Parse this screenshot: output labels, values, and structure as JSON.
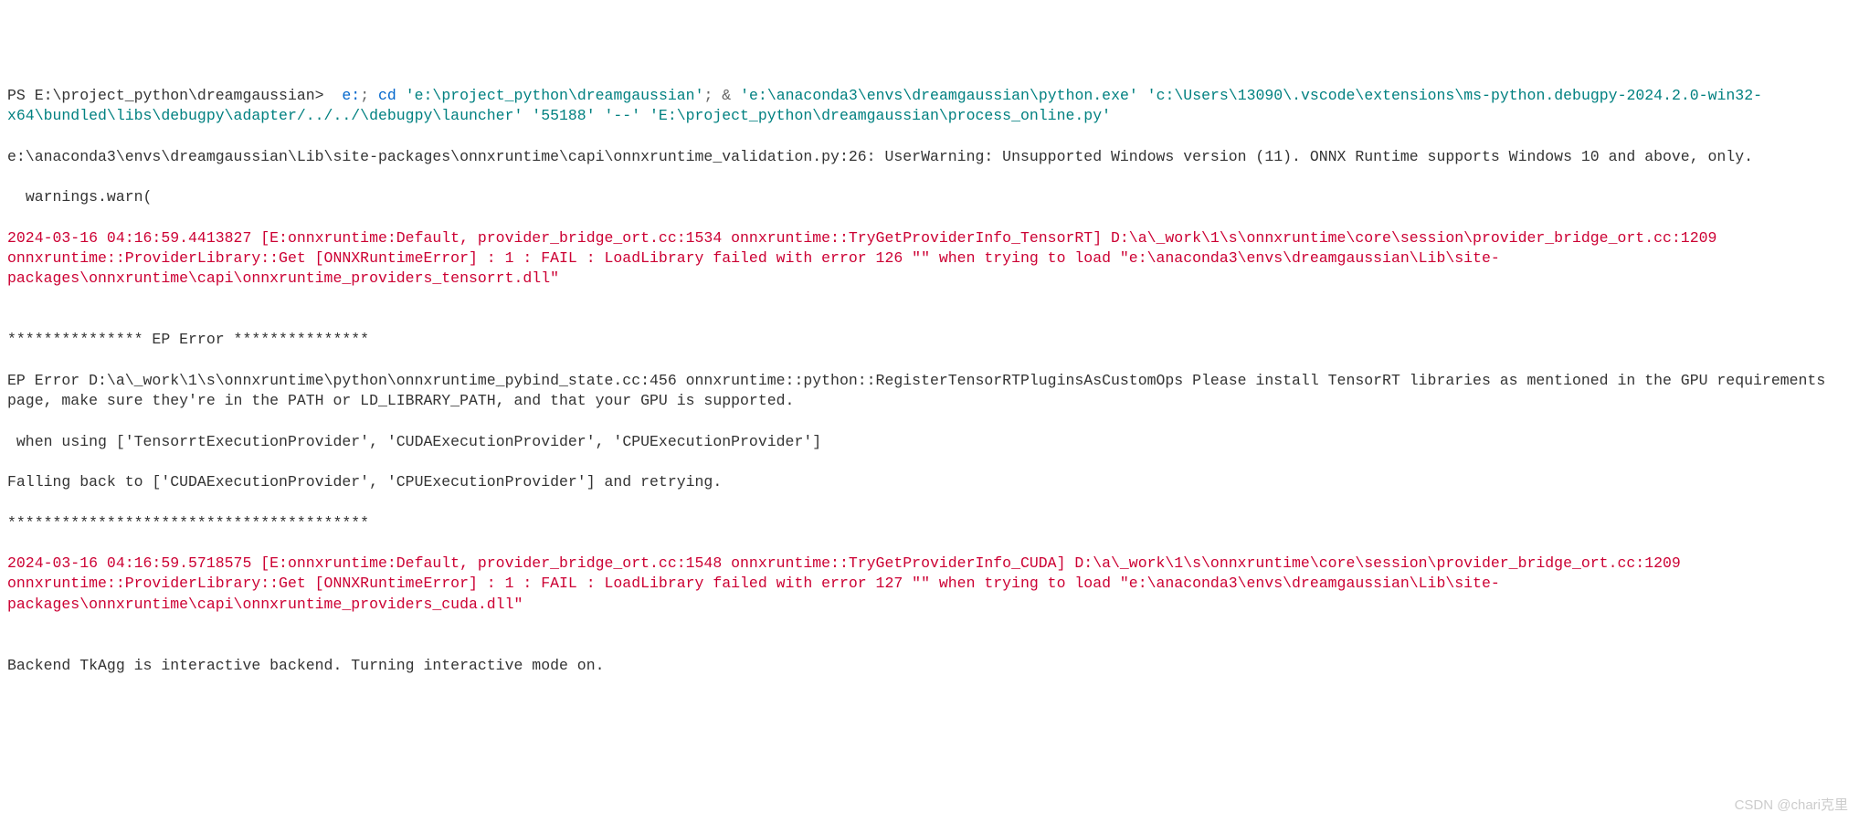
{
  "prompt": "PS E:\\project_python\\dreamgaussian>  ",
  "cmd_parts": {
    "part1": "e:",
    "part2": "; ",
    "part3": "cd",
    "part4": " ",
    "part5": "'e:\\project_python\\dreamgaussian'",
    "part6": "; ",
    "part7": "& ",
    "part8": "'e:\\anaconda3\\envs\\dreamgaussian\\python.exe' 'c:\\Users\\13090\\.vscode\\extensions\\ms-python.debugpy-2024.2.0-win32-x64\\bundled\\libs\\debugpy\\adapter/../../\\debugpy\\launcher' '55188' '--' 'E:\\project_python\\dreamgaussian\\process_online.py'"
  },
  "output": {
    "line1": "e:\\anaconda3\\envs\\dreamgaussian\\Lib\\site-packages\\onnxruntime\\capi\\onnxruntime_validation.py:26: UserWarning: Unsupported Windows version (11). ONNX Runtime supports Windows 10 and above, only.",
    "line2": "  warnings.warn(",
    "error1": "2024-03-16 04:16:59.4413827 [E:onnxruntime:Default, provider_bridge_ort.cc:1534 onnxruntime::TryGetProviderInfo_TensorRT] D:\\a\\_work\\1\\s\\onnxruntime\\core\\session\\provider_bridge_ort.cc:1209 onnxruntime::ProviderLibrary::Get [ONNXRuntimeError] : 1 : FAIL : LoadLibrary failed with error 126 \"\" when trying to load \"e:\\anaconda3\\envs\\dreamgaussian\\Lib\\site-packages\\onnxruntime\\capi\\onnxruntime_providers_tensorrt.dll\"",
    "blank1": "",
    "ep_header": "*************** EP Error ***************",
    "ep_line1": "EP Error D:\\a\\_work\\1\\s\\onnxruntime\\python\\onnxruntime_pybind_state.cc:456 onnxruntime::python::RegisterTensorRTPluginsAsCustomOps Please install TensorRT libraries as mentioned in the GPU requirements page, make sure they're in the PATH or LD_LIBRARY_PATH, and that your GPU is supported.",
    "ep_line2": " when using ['TensorrtExecutionProvider', 'CUDAExecutionProvider', 'CPUExecutionProvider']",
    "ep_line3": "Falling back to ['CUDAExecutionProvider', 'CPUExecutionProvider'] and retrying.",
    "ep_footer": "****************************************",
    "error2": "2024-03-16 04:16:59.5718575 [E:onnxruntime:Default, provider_bridge_ort.cc:1548 onnxruntime::TryGetProviderInfo_CUDA] D:\\a\\_work\\1\\s\\onnxruntime\\core\\session\\provider_bridge_ort.cc:1209 onnxruntime::ProviderLibrary::Get [ONNXRuntimeError] : 1 : FAIL : LoadLibrary failed with error 127 \"\" when trying to load \"e:\\anaconda3\\envs\\dreamgaussian\\Lib\\site-packages\\onnxruntime\\capi\\onnxruntime_providers_cuda.dll\"",
    "blank2": "",
    "backend": "Backend TkAgg is interactive backend. Turning interactive mode on."
  },
  "watermark": "CSDN @chari克里"
}
